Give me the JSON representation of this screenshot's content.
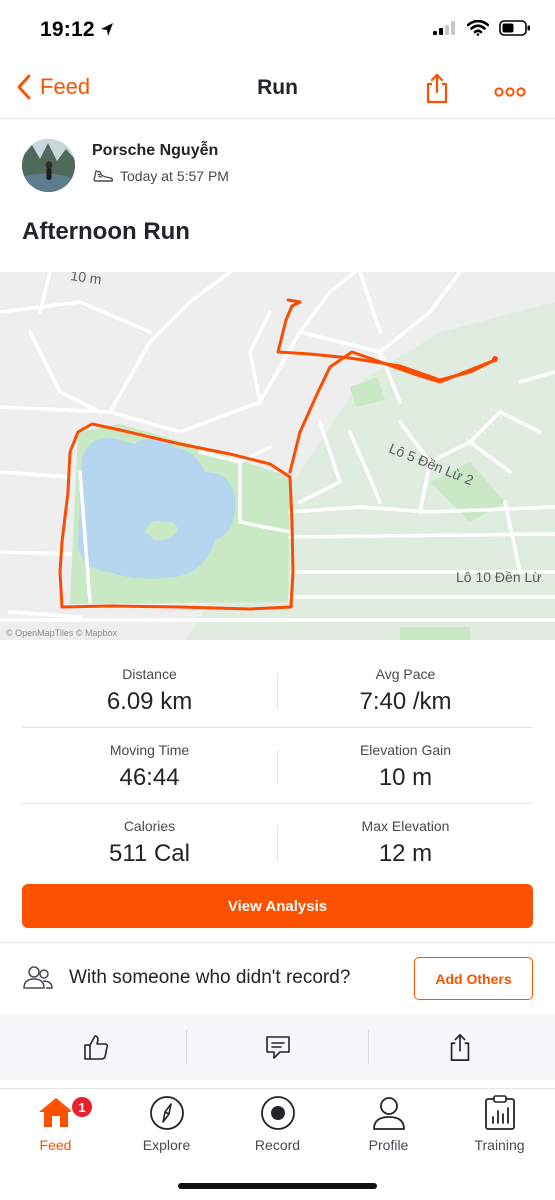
{
  "status_bar": {
    "time": "19:12"
  },
  "nav": {
    "back_label": "Feed",
    "title": "Run"
  },
  "athlete": {
    "name": "Porsche Nguyễn",
    "timestamp": "Today at 5:57 PM"
  },
  "activity": {
    "title": "Afternoon Run"
  },
  "map": {
    "street_labels": [
      "Lô 5 Đền Lừ 2",
      "Lô 10 Đền Lừ",
      "10 m"
    ],
    "attribution": "© OpenMapTiles © Mapbox"
  },
  "stats": [
    {
      "left": {
        "label": "Distance",
        "value": "6.09 km"
      },
      "right": {
        "label": "Avg Pace",
        "value": "7:40 /km"
      }
    },
    {
      "left": {
        "label": "Moving Time",
        "value": "46:44"
      },
      "right": {
        "label": "Elevation Gain",
        "value": "10 m"
      }
    },
    {
      "left": {
        "label": "Calories",
        "value": "511 Cal"
      },
      "right": {
        "label": "Max Elevation",
        "value": "12 m"
      }
    }
  ],
  "view_analysis_label": "View Analysis",
  "with_others": {
    "text": "With someone who didn't record?",
    "button_label": "Add Others"
  },
  "tabs": [
    {
      "label": "Feed",
      "icon": "home-icon",
      "badge": "1",
      "active": true
    },
    {
      "label": "Explore",
      "icon": "compass-icon"
    },
    {
      "label": "Record",
      "icon": "record-icon"
    },
    {
      "label": "Profile",
      "icon": "profile-icon"
    },
    {
      "label": "Training",
      "icon": "training-icon"
    }
  ],
  "colors": {
    "accent": "#fc5200",
    "badge": "#e8212d",
    "water": "#b5d6ee",
    "park": "#c9e8c4",
    "route": "#fc4c02"
  }
}
